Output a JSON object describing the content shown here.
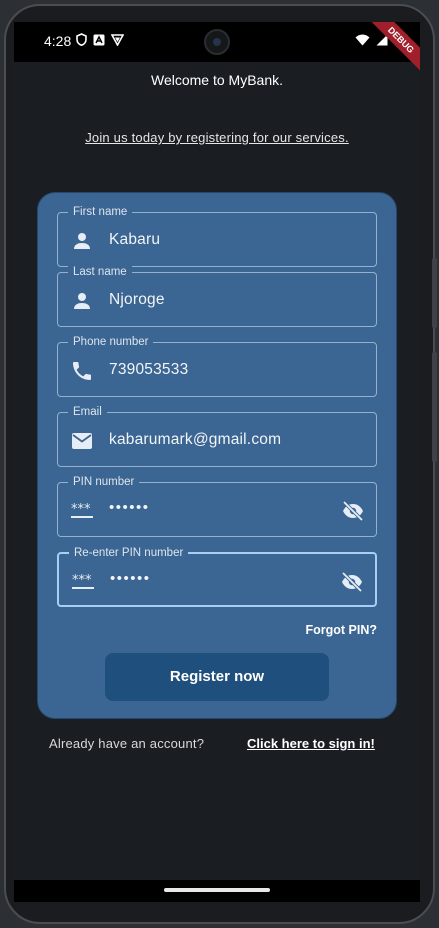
{
  "status_bar": {
    "time": "4:28"
  },
  "debug_banner": "DEBUG",
  "header": {
    "welcome": "Welcome to MyBank.",
    "join_link": "Join us today by registering for our services."
  },
  "form": {
    "first_name": {
      "label": "First name",
      "value": "Kabaru",
      "icon": "person-icon"
    },
    "last_name": {
      "label": "Last name",
      "value": "Njoroge",
      "icon": "person-icon"
    },
    "phone": {
      "label": "Phone number",
      "value": "739053533",
      "icon": "phone-icon"
    },
    "email": {
      "label": "Email",
      "value": "kabarumark@gmail.com",
      "icon": "mail-icon"
    },
    "pin": {
      "label": "PIN number",
      "value": "••••••",
      "icon": "password-icon"
    },
    "re_pin": {
      "label": "Re-enter PIN number",
      "value": "••••••",
      "icon": "password-icon"
    },
    "forgot_pin": "Forgot PIN?",
    "register_button": "Register now"
  },
  "footer": {
    "already": "Already have an account?",
    "signin_link": "Click here to sign in!"
  },
  "colors": {
    "background": "#1a1d22",
    "card": "#3b6592",
    "button": "#1f4f7c",
    "debug": "#a11f2b"
  }
}
